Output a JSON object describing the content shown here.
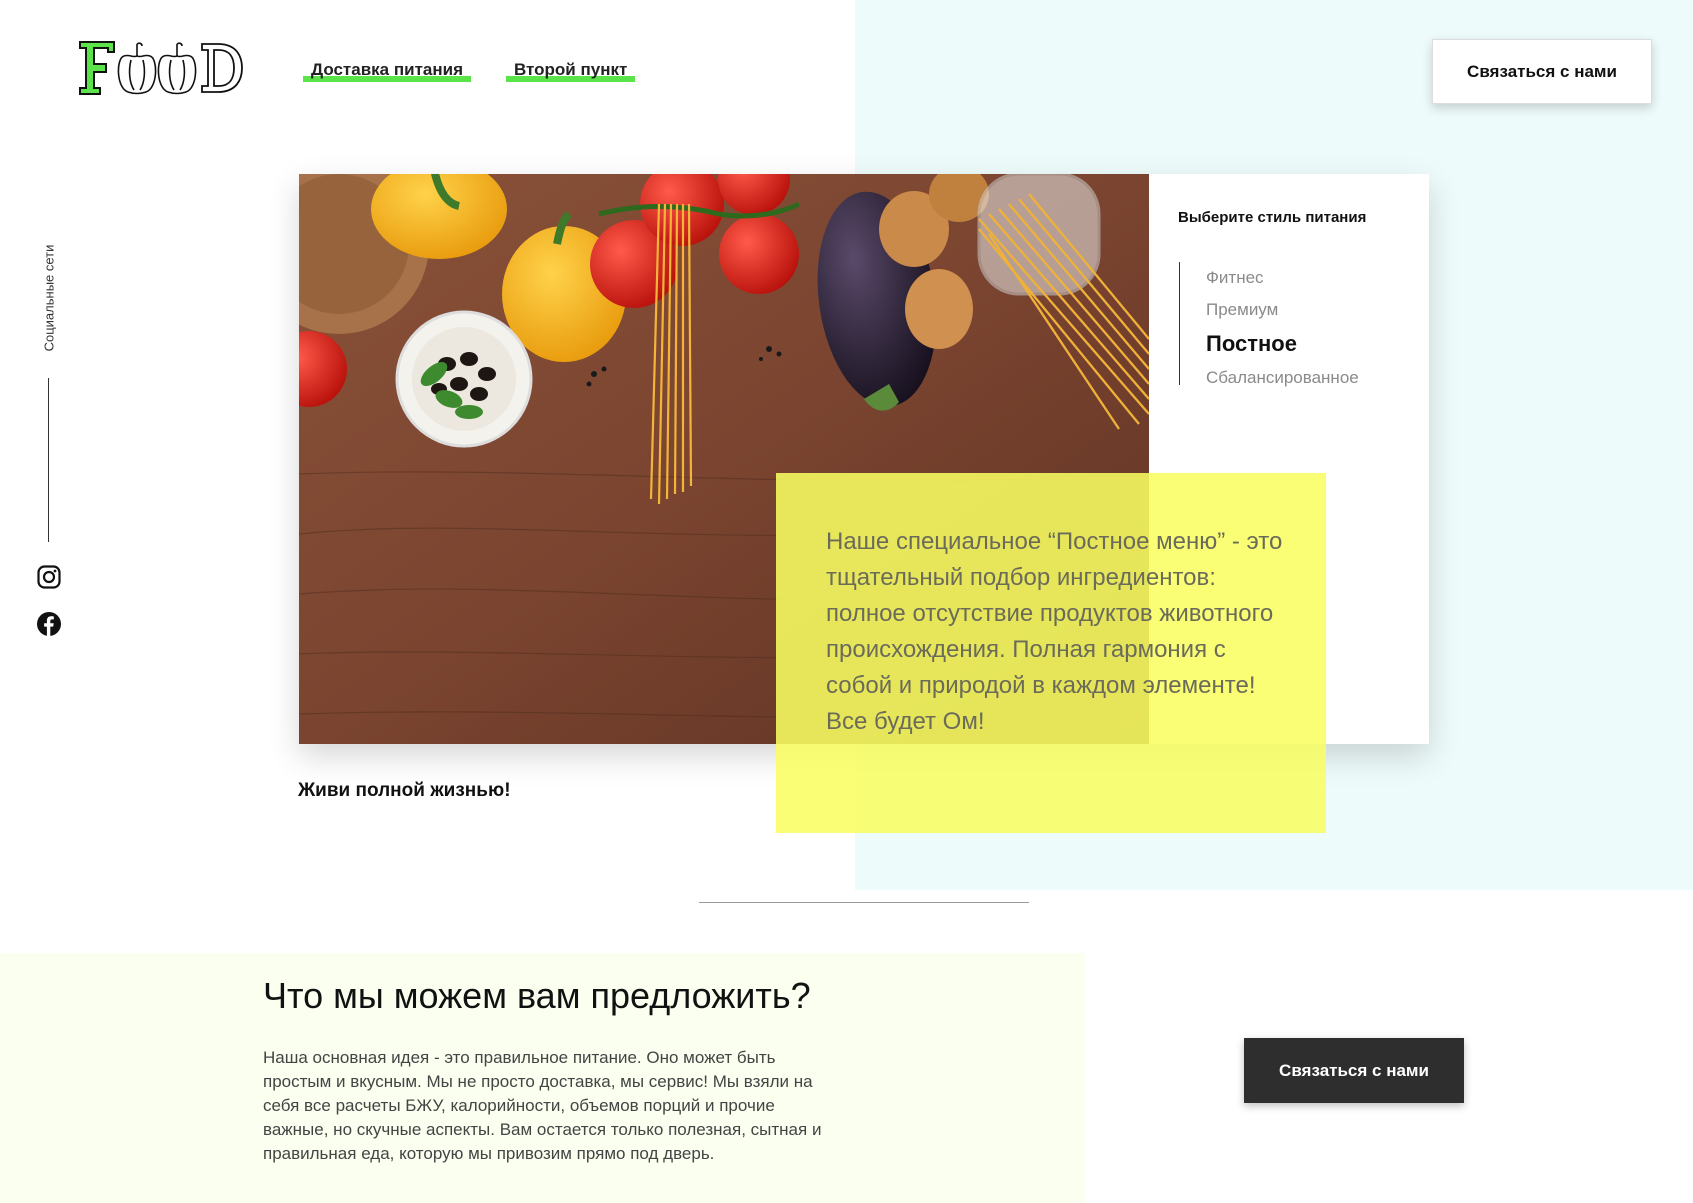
{
  "brand": {
    "logo_text": "FOOD",
    "accent_color": "#5be34a"
  },
  "nav": {
    "items": [
      {
        "label": "Доставка питания"
      },
      {
        "label": "Второй пункт"
      }
    ],
    "contact_label": "Связаться с нами"
  },
  "social": {
    "label": "Социальные сети",
    "icons": [
      "instagram-icon",
      "facebook-icon"
    ]
  },
  "hero": {
    "style_title": "Выберите стиль питания",
    "styles": [
      {
        "label": "Фитнес",
        "active": false
      },
      {
        "label": "Премиум",
        "active": false
      },
      {
        "label": "Постное",
        "active": true
      },
      {
        "label": "Сбалансированное",
        "active": false
      }
    ],
    "description": "Наше специальное “Постное меню” - это тщательный подбор ингредиентов: полное отсутствие продуктов животного происхождения. Полная гармония с собой и природой в каждом элементе! Все будет Ом!",
    "highlight_color": "#f8fe62",
    "tagline": "Живи полной жизнью!"
  },
  "offer": {
    "title": "Что мы можем вам предложить?",
    "text": "Наша основная идея - это правильное питание. Оно может быть простым и вкусным. Мы не просто доставка, мы сервис! Мы взяли на себя все расчеты БЖУ, калорийности, объемов порций и прочие важные, но скучные аспекты. Вам остается только полезная, сытная и правильная еда, которую мы привозим прямо под дверь.",
    "contact_label": "Связаться с нами"
  }
}
